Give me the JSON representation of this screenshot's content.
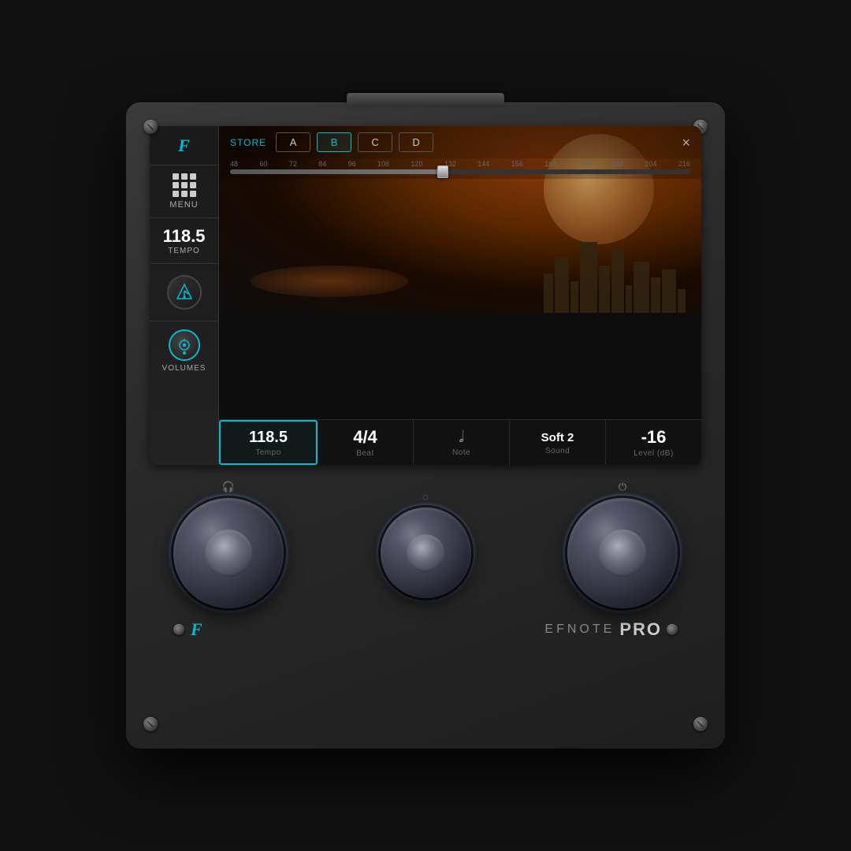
{
  "device": {
    "brand": "EFNOTE",
    "model": "PRO",
    "logo": "F"
  },
  "sidebar": {
    "logo": "F",
    "menu_label": "MENU",
    "tempo_value": "118.5",
    "tempo_label": "TEMPO",
    "volumes_label": "VOLUMES"
  },
  "controls": {
    "store_label": "STORE",
    "presets": [
      "A",
      "B",
      "C",
      "D"
    ],
    "active_preset": "B",
    "close_label": "×"
  },
  "slider": {
    "markers": [
      "48",
      "60",
      "72",
      "84",
      "96",
      "108",
      "120",
      "132",
      "144",
      "156",
      "168",
      "180",
      "192",
      "204",
      "216"
    ],
    "value": 118.5
  },
  "info": {
    "tempo": {
      "value": "118.5",
      "label": "Tempo"
    },
    "beat": {
      "value": "4/4",
      "label": "Beat"
    },
    "note": {
      "label": "Note"
    },
    "sound": {
      "value": "Soft 2",
      "label": "Sound"
    },
    "level": {
      "value": "-16",
      "label": "Level (dB)"
    }
  },
  "knobs": {
    "left_icon": "🎧",
    "middle_icon": "◌",
    "right_icon": "⏻"
  }
}
